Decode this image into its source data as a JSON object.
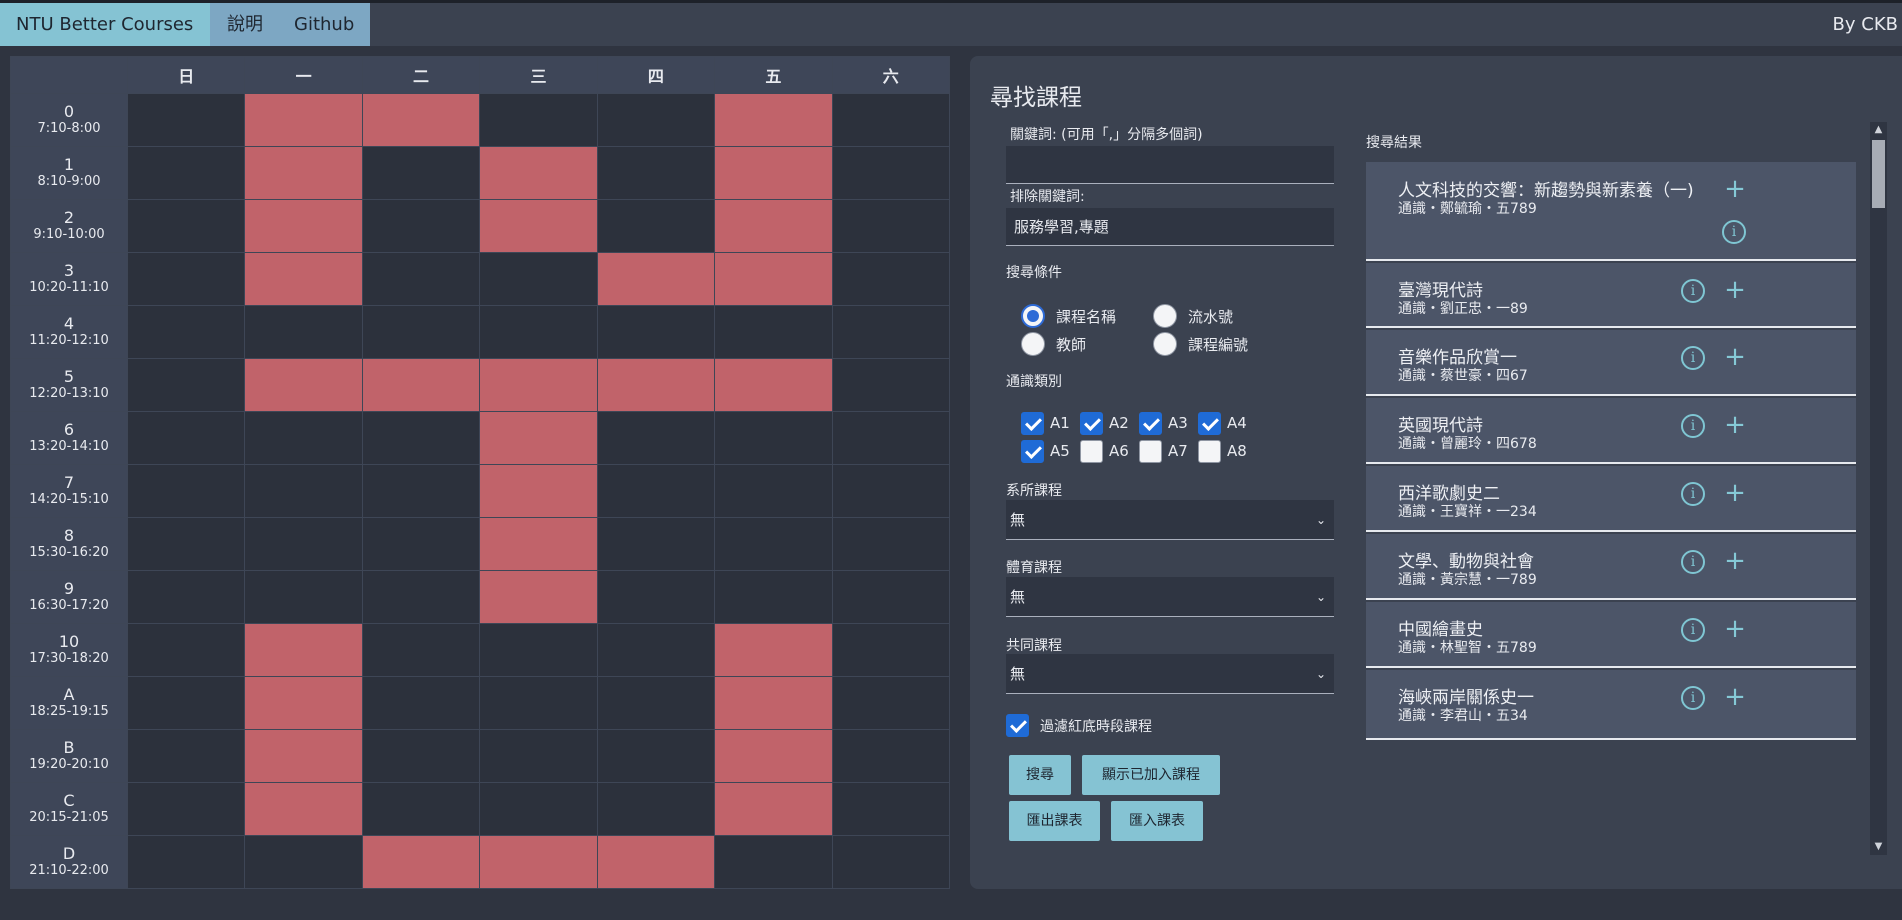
{
  "header": {
    "brand": "NTU Better Courses",
    "nav": [
      "說明",
      "Github"
    ],
    "byline": "By CKB"
  },
  "timetable": {
    "days": [
      "日",
      "一",
      "二",
      "三",
      "四",
      "五",
      "六"
    ],
    "periods": [
      {
        "name": "0",
        "time": "7:10-8:00"
      },
      {
        "name": "1",
        "time": "8:10-9:00"
      },
      {
        "name": "2",
        "time": "9:10-10:00"
      },
      {
        "name": "3",
        "time": "10:20-11:10"
      },
      {
        "name": "4",
        "time": "11:20-12:10"
      },
      {
        "name": "5",
        "time": "12:20-13:10"
      },
      {
        "name": "6",
        "time": "13:20-14:10"
      },
      {
        "name": "7",
        "time": "14:20-15:10"
      },
      {
        "name": "8",
        "time": "15:30-16:20"
      },
      {
        "name": "9",
        "time": "16:30-17:20"
      },
      {
        "name": "10",
        "time": "17:30-18:20"
      },
      {
        "name": "A",
        "time": "18:25-19:15"
      },
      {
        "name": "B",
        "time": "19:20-20:10"
      },
      {
        "name": "C",
        "time": "20:15-21:05"
      },
      {
        "name": "D",
        "time": "21:10-22:00"
      }
    ],
    "busy": [
      [
        0,
        1,
        1,
        0,
        0,
        1,
        0
      ],
      [
        0,
        1,
        0,
        1,
        0,
        1,
        0
      ],
      [
        0,
        1,
        0,
        1,
        0,
        1,
        0
      ],
      [
        0,
        1,
        0,
        0,
        1,
        1,
        0
      ],
      [
        0,
        0,
        0,
        0,
        0,
        0,
        0
      ],
      [
        0,
        1,
        1,
        1,
        1,
        1,
        0
      ],
      [
        0,
        0,
        0,
        1,
        0,
        0,
        0
      ],
      [
        0,
        0,
        0,
        1,
        0,
        0,
        0
      ],
      [
        0,
        0,
        0,
        1,
        0,
        0,
        0
      ],
      [
        0,
        0,
        0,
        1,
        0,
        0,
        0
      ],
      [
        0,
        1,
        0,
        0,
        0,
        1,
        0
      ],
      [
        0,
        1,
        0,
        0,
        0,
        1,
        0
      ],
      [
        0,
        1,
        0,
        0,
        0,
        1,
        0
      ],
      [
        0,
        1,
        0,
        0,
        0,
        1,
        0
      ],
      [
        0,
        0,
        1,
        1,
        1,
        0,
        0
      ]
    ],
    "busy_color": "#c1636a"
  },
  "search": {
    "title": "尋找課程",
    "keyword_label": "關鍵詞: (可用「,」分隔多個詞)",
    "keyword_value": "",
    "exclude_label": "排除關鍵詞:",
    "exclude_value": "服務學習,專題",
    "criteria_label": "搜尋條件",
    "criteria": [
      {
        "label": "課程名稱",
        "selected": true
      },
      {
        "label": "流水號",
        "selected": false
      },
      {
        "label": "教師",
        "selected": false
      },
      {
        "label": "課程編號",
        "selected": false
      }
    ],
    "ge_label": "通識類別",
    "ge_types": [
      {
        "label": "A1",
        "checked": true
      },
      {
        "label": "A2",
        "checked": true
      },
      {
        "label": "A3",
        "checked": true
      },
      {
        "label": "A4",
        "checked": true
      },
      {
        "label": "A5",
        "checked": true
      },
      {
        "label": "A6",
        "checked": false
      },
      {
        "label": "A7",
        "checked": false
      },
      {
        "label": "A8",
        "checked": false
      }
    ],
    "dept_label": "系所課程",
    "dept_value": "無",
    "pe_label": "體育課程",
    "pe_value": "無",
    "common_label": "共同課程",
    "common_value": "無",
    "filter_label": "過濾紅底時段課程",
    "filter_checked": true,
    "buttons": {
      "search": "搜尋",
      "show_added": "顯示已加入課程",
      "export": "匯出課表",
      "import": "匯入課表"
    }
  },
  "results": {
    "title": "搜尋結果",
    "items": [
      {
        "name": "人文科技的交響：新趨勢與新素養（一)",
        "meta": "通識・鄭毓瑜・五789"
      },
      {
        "name": "臺灣現代詩",
        "meta": "通識・劉正忠・一89"
      },
      {
        "name": "音樂作品欣賞一",
        "meta": "通識・蔡世豪・四67"
      },
      {
        "name": "英國現代詩",
        "meta": "通識・曾麗玲・四678"
      },
      {
        "name": "西洋歌劇史二",
        "meta": "通識・王寶祥・一234"
      },
      {
        "name": "文學、動物與社會",
        "meta": "通識・黃宗慧・一789"
      },
      {
        "name": "中國繪畫史",
        "meta": "通識・林聖智・五789"
      },
      {
        "name": "海峽兩岸關係史一",
        "meta": "通識・李君山・五34"
      }
    ]
  },
  "icons": {
    "info": "info-circle-icon",
    "add": "plus-icon",
    "dropdown": "chevron-down-icon"
  }
}
